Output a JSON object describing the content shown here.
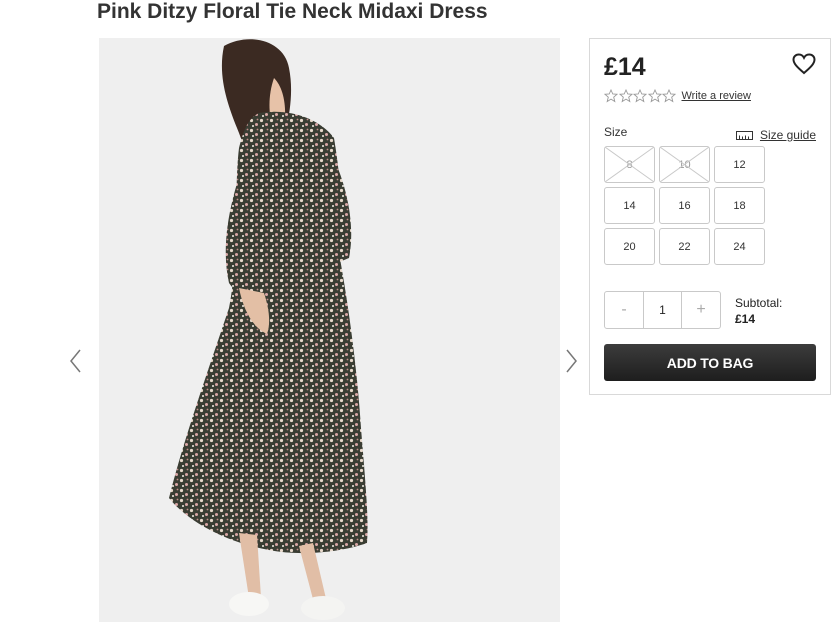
{
  "product": {
    "title": "Pink Ditzy Floral Tie Neck Midaxi Dress"
  },
  "gallery": {
    "prev_icon": "chevron-left-icon",
    "next_icon": "chevron-right-icon",
    "image": "product-photo"
  },
  "buy_panel": {
    "price": "£14",
    "wishlist_icon": "heart-icon",
    "rating": {
      "stars": 0,
      "max": 5,
      "write_review": "Write a review"
    },
    "size": {
      "label": "Size",
      "guide_label": "Size guide",
      "guide_icon": "ruler-icon",
      "options": [
        {
          "label": "8",
          "available": false
        },
        {
          "label": "10",
          "available": false
        },
        {
          "label": "12",
          "available": true
        },
        {
          "label": "14",
          "available": true
        },
        {
          "label": "16",
          "available": true
        },
        {
          "label": "18",
          "available": true
        },
        {
          "label": "20",
          "available": true
        },
        {
          "label": "22",
          "available": true
        },
        {
          "label": "24",
          "available": true
        }
      ]
    },
    "quantity": {
      "minus": "-",
      "value": "1",
      "plus": "+"
    },
    "subtotal": {
      "label": "Subtotal:",
      "amount": "£14"
    },
    "add_to_bag": "ADD TO BAG"
  },
  "colors": {
    "button_bg": "#2b2b2b",
    "border": "#c9c9c9"
  }
}
